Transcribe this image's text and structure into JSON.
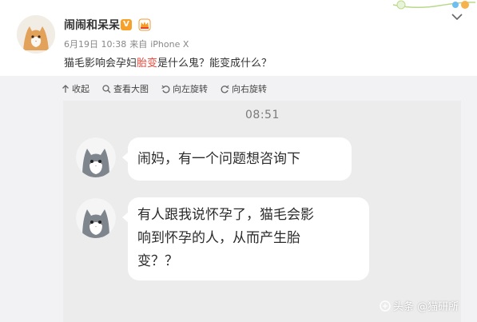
{
  "post": {
    "username": "闹闹和呆呆",
    "verified_badge": "V",
    "date": "6月19日 10:38",
    "source_prefix": "来自",
    "source_device": "iPhone X",
    "text_before": "猫毛影响会孕妇",
    "text_highlight": "胎变",
    "text_after": "是什么鬼？能变成什么？"
  },
  "toolbar": {
    "collapse": "收起",
    "view_large": "查看大图",
    "rotate_left": "向左旋转",
    "rotate_right": "向右旋转"
  },
  "chat": {
    "time": "08:51",
    "messages": [
      {
        "lines": [
          "闹妈，有一个问题想咨询下"
        ]
      },
      {
        "lines": [
          "有人跟我说怀孕了，猫毛会影",
          "响到怀孕的人，从而产生胎",
          "变？？"
        ]
      }
    ]
  },
  "watermark": "头条 @猫研所",
  "colors": {
    "highlight": "#e44a3d",
    "badge": "#f7a12a",
    "chat_bg": "#ececec",
    "bubble": "#ffffff"
  },
  "icons": [
    "chevron-down-icon",
    "collapse-arrow-icon",
    "search-icon",
    "rotate-left-icon",
    "rotate-right-icon",
    "crown-badge-icon",
    "toutiao-logo-icon"
  ]
}
